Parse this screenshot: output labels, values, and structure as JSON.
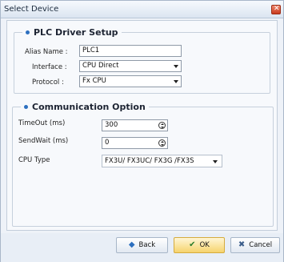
{
  "window": {
    "title": "Select Device"
  },
  "plc_driver_setup": {
    "title": "PLC Driver Setup",
    "alias_label": "Alias Name :",
    "alias_value": "PLC1",
    "interface_label": "Interface :",
    "interface_value": "CPU Direct",
    "protocol_label": "Protocol :",
    "protocol_value": "Fx CPU"
  },
  "communication_option": {
    "title": "Communication Option",
    "timeout_label": "TimeOut (ms)",
    "timeout_value": "300",
    "sendwait_label": "SendWait (ms)",
    "sendwait_value": "0",
    "cputype_label": "CPU Type",
    "cputype_value": "FX3U/ FX3UC/ FX3G /FX3S"
  },
  "footer": {
    "back_label": "Back",
    "ok_label": "OK",
    "cancel_label": "Cancel"
  },
  "colors": {
    "accent": "#2c6fbf",
    "ok": "#f6d36d",
    "close": "#c8391d"
  },
  "icons": {
    "back": "left-arrow-icon",
    "ok": "checkmark-icon",
    "cancel": "x-icon",
    "close": "close-icon"
  }
}
